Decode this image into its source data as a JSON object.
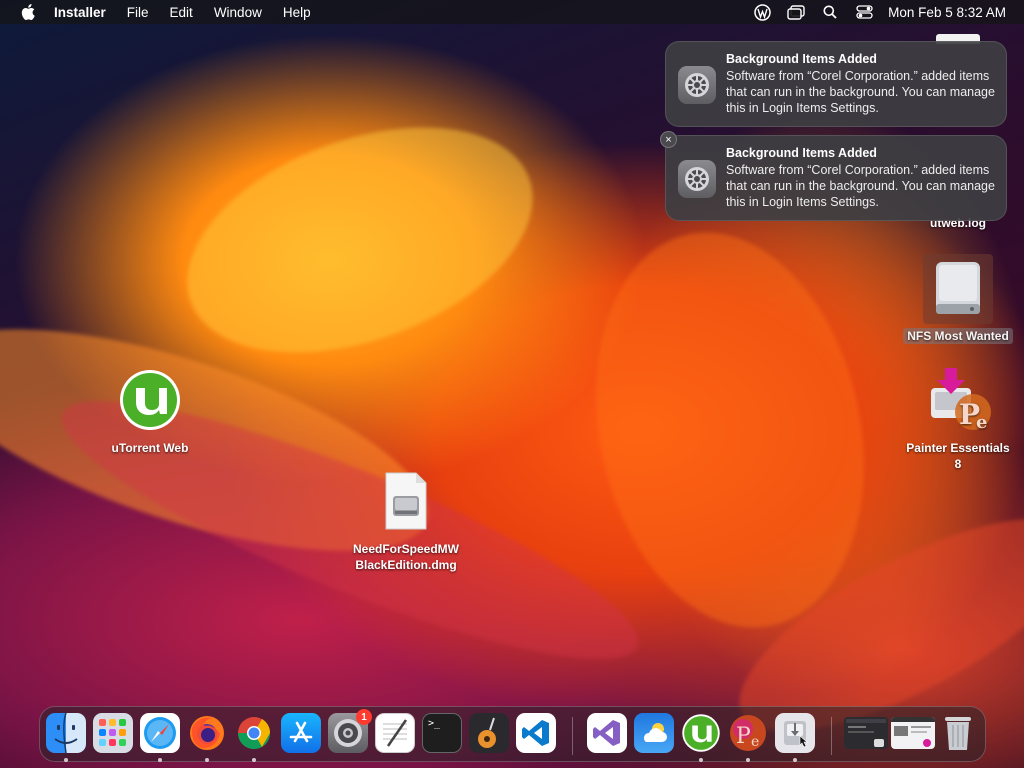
{
  "menubar": {
    "app_name": "Installer",
    "items": [
      "File",
      "Edit",
      "Window",
      "Help"
    ],
    "clock": "Mon Feb 5  8:32 AM",
    "status_icons": [
      "wordpress-icon",
      "window-icon",
      "search-icon",
      "control-center-icon"
    ]
  },
  "notifications": [
    {
      "title": "Background Items Added",
      "body": "Software from “Corel Corporation.” added items that can run in the background. You can manage this in Login Items Settings."
    },
    {
      "title": "Background Items Added",
      "body": "Software from “Corel Corporation.” added items that can run in the background. You can manage this in Login Items Settings."
    }
  ],
  "notification_close": "×",
  "desktop": {
    "utorrent": "uTorrent Web",
    "dmg": "NeedForSpeedMW BlackEdition.dmg",
    "utweb_log": "utweb.log",
    "nfs": "NFS Most Wanted",
    "painter": "Painter Essentials 8"
  },
  "dock": {
    "settings_badge": "1",
    "terminal_prompt": ">_",
    "apps": [
      "finder-icon",
      "launchpad-icon",
      "safari-icon",
      "firefox-icon",
      "chrome-icon",
      "app-store-icon",
      "system-settings-icon",
      "textedit-icon",
      "terminal-icon",
      "garageband-icon",
      "vscode-icon",
      "visual-studio-icon",
      "weather-icon",
      "utorrent-icon",
      "painter-icon",
      "installer-icon",
      "window-preview-1",
      "window-preview-2",
      "trash-icon"
    ]
  },
  "colors": {
    "utorrent_green": "#4caf28",
    "badge_red": "#ff3b30"
  }
}
